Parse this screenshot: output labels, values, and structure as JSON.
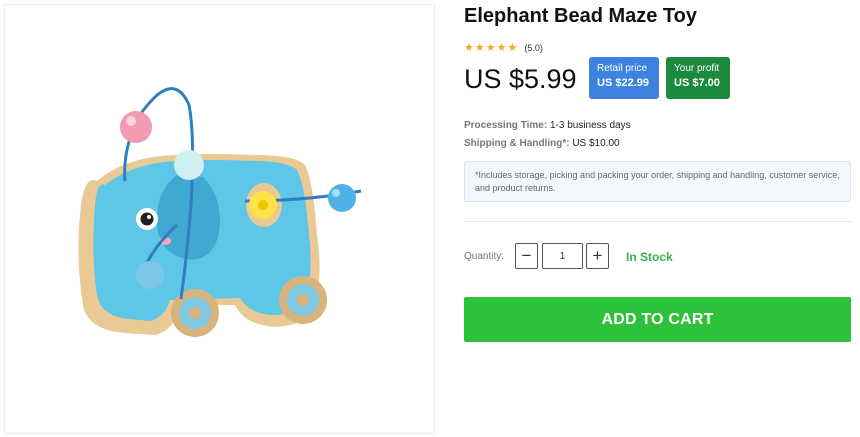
{
  "product": {
    "title": "Elephant Bead Maze Toy",
    "rating_text": "(5.0)",
    "stars": 5,
    "price": "US $5.99",
    "image_icon": "elephant-bead-maze-toy-image"
  },
  "badges": {
    "retail_label": "Retail price",
    "retail_value": "US $22.99",
    "profit_label": "Your profit",
    "profit_value": "US $7.00"
  },
  "info": {
    "processing_label": "Processing Time:",
    "processing_value": "1-3 business days",
    "shipping_label": "Shipping & Handling*:",
    "shipping_value": "US $10.00",
    "note": "*Includes storage, picking and packing your order, shipping and handling, customer service, and product returns."
  },
  "quantity": {
    "label": "Quantity:",
    "minus": "−",
    "value": "1",
    "plus": "+",
    "stock": "In Stock"
  },
  "cart": {
    "label": "ADD TO CART"
  },
  "colors": {
    "retail_badge": "#3d82e0",
    "profit_badge": "#1c8a3c",
    "cart_button": "#2ec23b",
    "in_stock": "#36b24a",
    "star": "#f5a623"
  }
}
